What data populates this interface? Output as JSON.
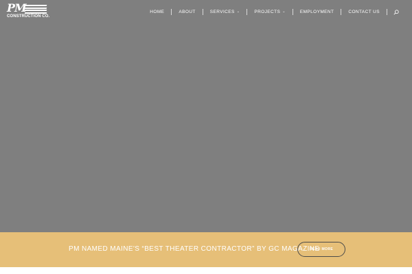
{
  "logo": {
    "mark": "PM",
    "subtitle": "CONSTRUCTION CO."
  },
  "nav": {
    "items": [
      {
        "label": "HOME",
        "dropdown": false
      },
      {
        "label": "ABOUT",
        "dropdown": false
      },
      {
        "label": "SERVICES",
        "dropdown": true
      },
      {
        "label": "PROJECTS",
        "dropdown": true
      },
      {
        "label": "EMPLOYMENT",
        "dropdown": false
      },
      {
        "label": "CONTACT US",
        "dropdown": false
      }
    ],
    "search_icon": "search-icon"
  },
  "banner": {
    "headline": "PM NAMED MAINE'S “BEST THEATER CONTRACTOR” BY GC MAGAZINE",
    "button_label": "READ MORE"
  },
  "colors": {
    "hero_bg": "#7f7f7f",
    "banner_bg": "#e6bf78",
    "text_light": "#ffffff",
    "button_border": "#4a4a4a"
  }
}
